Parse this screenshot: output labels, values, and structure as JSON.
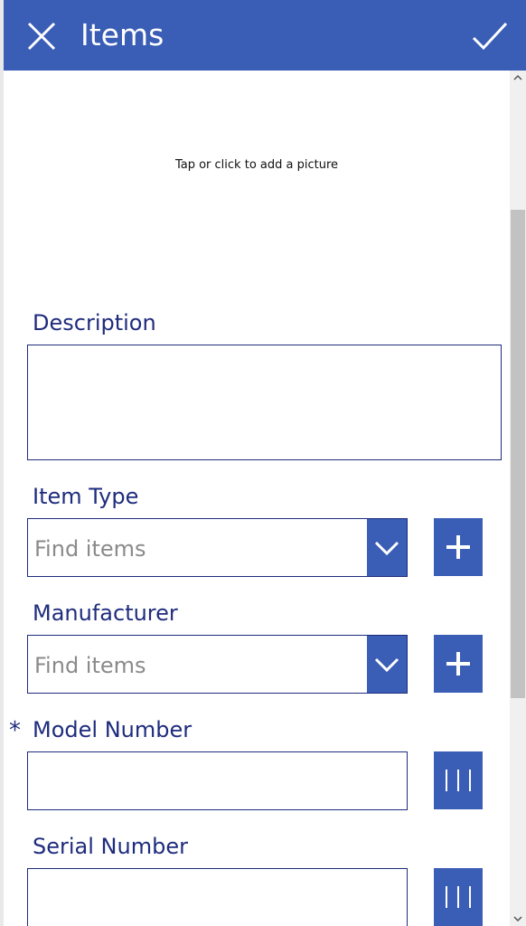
{
  "theme": {
    "accent": "#3a5db5",
    "label": "#1f2c7d"
  },
  "header": {
    "title": "Items",
    "close_icon": "close-icon",
    "confirm_icon": "checkmark-icon"
  },
  "picture": {
    "prompt": "Tap or click to add a picture"
  },
  "form": {
    "description": {
      "label": "Description",
      "value": ""
    },
    "item_type": {
      "label": "Item Type",
      "placeholder": "Find items",
      "add_icon": "plus-icon"
    },
    "manufacturer": {
      "label": "Manufacturer",
      "placeholder": "Find items",
      "add_icon": "plus-icon"
    },
    "model_number": {
      "label": "Model Number",
      "required_marker": "*",
      "value": "",
      "scan_icon": "barcode-icon"
    },
    "serial_number": {
      "label": "Serial Number",
      "value": "",
      "scan_icon": "barcode-icon"
    }
  }
}
